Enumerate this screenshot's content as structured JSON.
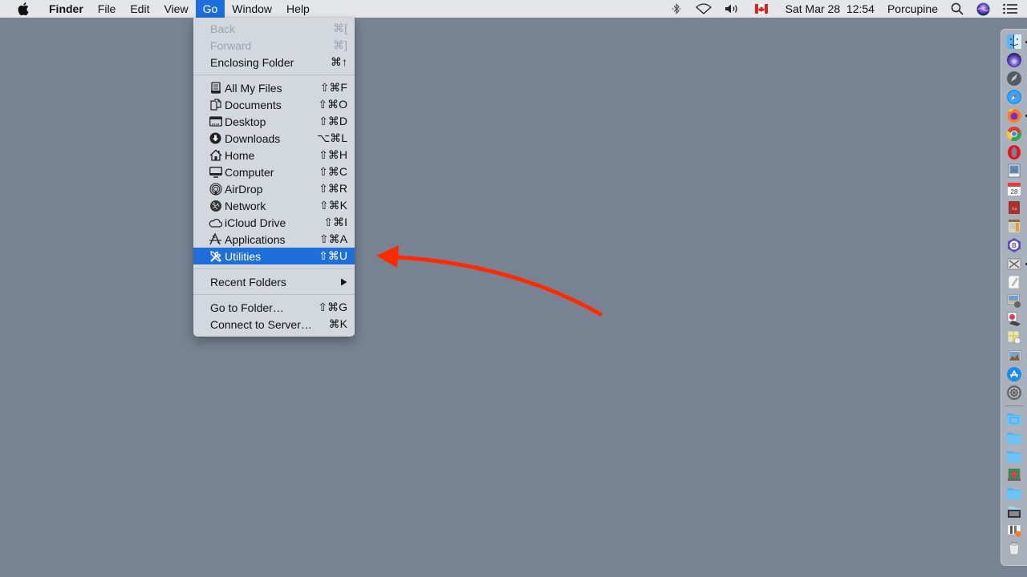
{
  "menubar": {
    "apple_icon": "apple-logo-icon",
    "app_name": "Finder",
    "menus": [
      "File",
      "Edit",
      "View",
      "Go",
      "Window",
      "Help"
    ],
    "active_menu": "Go",
    "status": {
      "bluetooth_icon": "bluetooth-icon",
      "wifi_icon": "wifi-icon",
      "volume_icon": "volume-icon",
      "input_source_icon": "canada-flag-icon",
      "datetime": "Sat Mar 28  12:54",
      "user": "Porcupine",
      "spotlight_icon": "search-icon",
      "siri_icon": "siri-icon",
      "notification_icon": "notification-center-icon"
    }
  },
  "go_menu": {
    "nav_items": [
      {
        "label": "Back",
        "shortcut": "⌘[",
        "enabled": false
      },
      {
        "label": "Forward",
        "shortcut": "⌘]",
        "enabled": false
      },
      {
        "label": "Enclosing Folder",
        "shortcut": "⌘↑",
        "enabled": true
      }
    ],
    "places": [
      {
        "label": "All My Files",
        "shortcut": "⇧⌘F",
        "icon": "all-files-icon"
      },
      {
        "label": "Documents",
        "shortcut": "⇧⌘O",
        "icon": "documents-icon"
      },
      {
        "label": "Desktop",
        "shortcut": "⇧⌘D",
        "icon": "desktop-icon"
      },
      {
        "label": "Downloads",
        "shortcut": "⌥⌘L",
        "icon": "downloads-icon"
      },
      {
        "label": "Home",
        "shortcut": "⇧⌘H",
        "icon": "home-icon"
      },
      {
        "label": "Computer",
        "shortcut": "⇧⌘C",
        "icon": "computer-icon"
      },
      {
        "label": "AirDrop",
        "shortcut": "⇧⌘R",
        "icon": "airdrop-icon"
      },
      {
        "label": "Network",
        "shortcut": "⇧⌘K",
        "icon": "network-icon"
      },
      {
        "label": "iCloud Drive",
        "shortcut": "⇧⌘I",
        "icon": "icloud-icon"
      },
      {
        "label": "Applications",
        "shortcut": "⇧⌘A",
        "icon": "applications-icon"
      },
      {
        "label": "Utilities",
        "shortcut": "⇧⌘U",
        "icon": "utilities-icon",
        "selected": true
      }
    ],
    "recent_folders": {
      "label": "Recent Folders",
      "submenu_icon": "submenu-arrow-icon"
    },
    "footer_items": [
      {
        "label": "Go to Folder…",
        "shortcut": "⇧⌘G"
      },
      {
        "label": "Connect to Server…",
        "shortcut": "⌘K"
      }
    ]
  },
  "annotation": {
    "type": "arrow",
    "color": "#ff2a00",
    "points_to": "Utilities"
  },
  "dock": {
    "apps": [
      {
        "name": "Finder",
        "running": true
      },
      {
        "name": "Siri",
        "running": false
      },
      {
        "name": "Launchpad",
        "running": false
      },
      {
        "name": "Safari",
        "running": false
      },
      {
        "name": "Firefox",
        "running": true
      },
      {
        "name": "Chrome",
        "running": false
      },
      {
        "name": "Opera",
        "running": false
      },
      {
        "name": "Preview",
        "running": false
      },
      {
        "name": "Calendar",
        "running": false,
        "badge": "28"
      },
      {
        "name": "Dictionary",
        "running": false
      },
      {
        "name": "Notes",
        "running": false
      },
      {
        "name": "BBEdit",
        "running": false
      },
      {
        "name": "Screenshot",
        "running": true
      },
      {
        "name": "TextEdit",
        "running": false
      },
      {
        "name": "Image Capture",
        "running": false
      },
      {
        "name": "Photo Viewer",
        "running": false
      },
      {
        "name": "Maps",
        "running": false
      },
      {
        "name": "Photos",
        "running": false
      },
      {
        "name": "App Store",
        "running": false
      },
      {
        "name": "System Preferences",
        "running": false
      }
    ],
    "folders": [
      {
        "name": "Applications folder"
      },
      {
        "name": "Folder"
      },
      {
        "name": "Folder"
      },
      {
        "name": "Pictures stack"
      },
      {
        "name": "Folder"
      },
      {
        "name": "Downloads stack"
      },
      {
        "name": "Documents stack"
      },
      {
        "name": "Trash"
      }
    ]
  },
  "colors": {
    "desktop": "#778393",
    "menu_highlight": "#1e6fd9",
    "arrow": "#ff2a00"
  }
}
